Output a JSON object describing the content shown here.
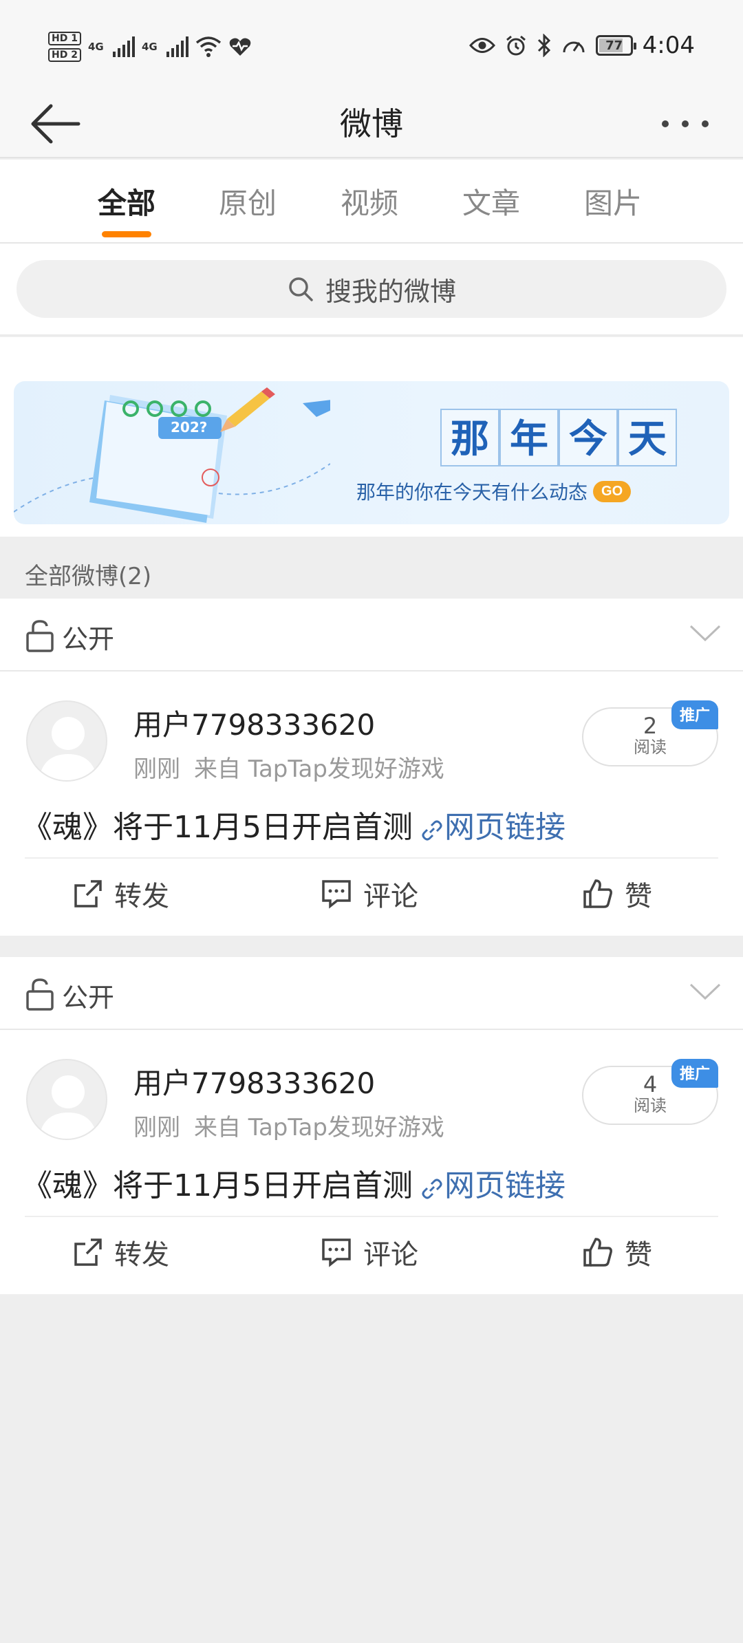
{
  "status_bar": {
    "hd1": "HD 1",
    "hd2": "HD 2",
    "net1": "4G",
    "net2": "4G",
    "battery": "77",
    "time": "4:04"
  },
  "header": {
    "title": "微博"
  },
  "tabs": [
    {
      "label": "全部"
    },
    {
      "label": "原创"
    },
    {
      "label": "视频"
    },
    {
      "label": "文章"
    },
    {
      "label": "图片"
    }
  ],
  "search": {
    "placeholder": "搜我的微博"
  },
  "banner": {
    "title_chars": [
      "那",
      "年",
      "今",
      "天"
    ],
    "subtitle": "那年的你在今天有什么动态",
    "go": "GO",
    "calendar_year": "202?"
  },
  "section": {
    "label": "全部微博(2)"
  },
  "posts": [
    {
      "visibility": "公开",
      "username": "用户7798333620",
      "time": "刚刚",
      "source": "来自 TapTap发现好游戏",
      "reads": "2",
      "reads_label": "阅读",
      "promo": "推广",
      "text": "《魂》将于11月5日开启首测",
      "link": "网页链接",
      "actions": {
        "repost": "转发",
        "comment": "评论",
        "like": "赞"
      }
    },
    {
      "visibility": "公开",
      "username": "用户7798333620",
      "time": "刚刚",
      "source": "来自 TapTap发现好游戏",
      "reads": "4",
      "reads_label": "阅读",
      "promo": "推广",
      "text": "《魂》将于11月5日开启首测",
      "link": "网页链接",
      "actions": {
        "repost": "转发",
        "comment": "评论",
        "like": "赞"
      }
    }
  ],
  "colors": {
    "accent": "#ff8200",
    "link": "#3e6fb0",
    "promo": "#3d8ee5",
    "banner_text": "#1f62b8"
  }
}
